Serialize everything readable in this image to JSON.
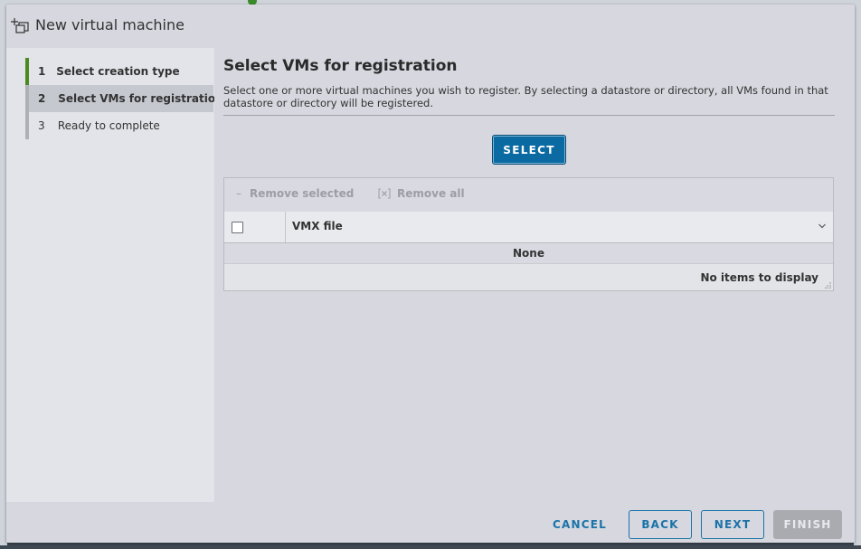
{
  "dialog": {
    "title": "New virtual machine",
    "icon": "new-vm-icon"
  },
  "steps": [
    {
      "number": "1",
      "label": "Select creation type",
      "state": "done"
    },
    {
      "number": "2",
      "label": "Select VMs for registration",
      "state": "current"
    },
    {
      "number": "3",
      "label": "Ready to complete",
      "state": "pending"
    }
  ],
  "main": {
    "title": "Select VMs for registration",
    "description": "Select one or more virtual machines you wish to register. By selecting a datastore or directory, all VMs found in that datastore or directory will be registered.",
    "select_button": "SELECT"
  },
  "grid": {
    "toolbar": {
      "remove_selected_icon": "minus-icon",
      "remove_selected": "Remove selected",
      "remove_all_icon": "remove-all-icon",
      "remove_all": "Remove all"
    },
    "columns": [
      "VMX file"
    ],
    "placeholder": "None",
    "footer": "No items to display"
  },
  "footer": {
    "cancel": "CANCEL",
    "back": "BACK",
    "next": "NEXT",
    "finish": "FINISH"
  },
  "colors": {
    "primary": "#0a6aa1",
    "link": "#1a73a8",
    "step_done": "#4c8a20",
    "disabled": "#a9abb1"
  }
}
